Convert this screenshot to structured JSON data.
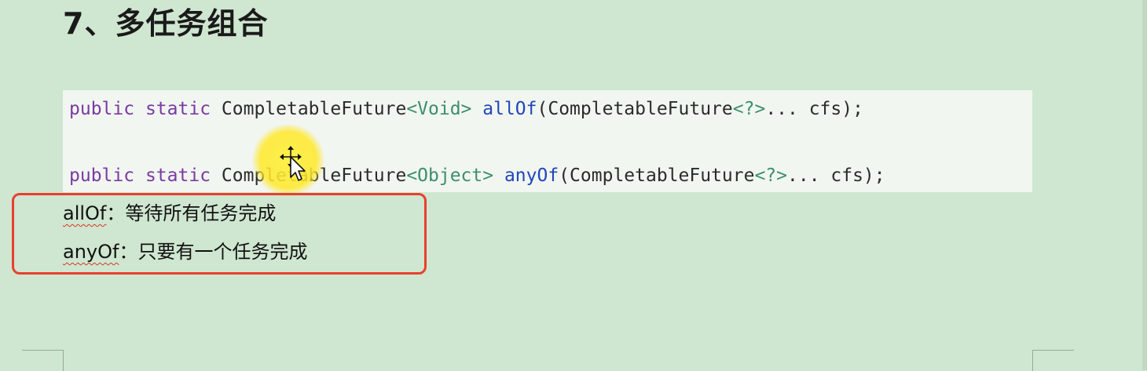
{
  "heading": "7、多任务组合",
  "code": {
    "line1": {
      "modifier1": "public",
      "modifier2": "static",
      "type": "CompletableFuture",
      "generic": "<Void>",
      "method": "allOf",
      "paren_open": "(CompletableFuture",
      "param_generic": "<?>",
      "param_rest": "... cfs);"
    },
    "line2": {
      "modifier1": "public",
      "modifier2": "static",
      "type": "CompletableFuture",
      "generic": "<Object>",
      "method": "anyOf",
      "paren_open": "(CompletableFuture",
      "param_generic": "<?>",
      "param_rest": "... cfs);"
    }
  },
  "notes": [
    {
      "term": "allOf",
      "separator": "：",
      "desc": "等待所有任务完成"
    },
    {
      "term": "anyOf",
      "separator": "：",
      "desc": "只要有一个任务完成"
    }
  ],
  "colors": {
    "background": "#cfe6d0",
    "highlight_border": "#e8402f",
    "cursor_highlight": "#fff03c",
    "keyword": "#7b3aa3",
    "generic": "#3d8f6a",
    "method": "#2246b8"
  },
  "icons": {
    "cursor": "move-cursor-icon"
  }
}
